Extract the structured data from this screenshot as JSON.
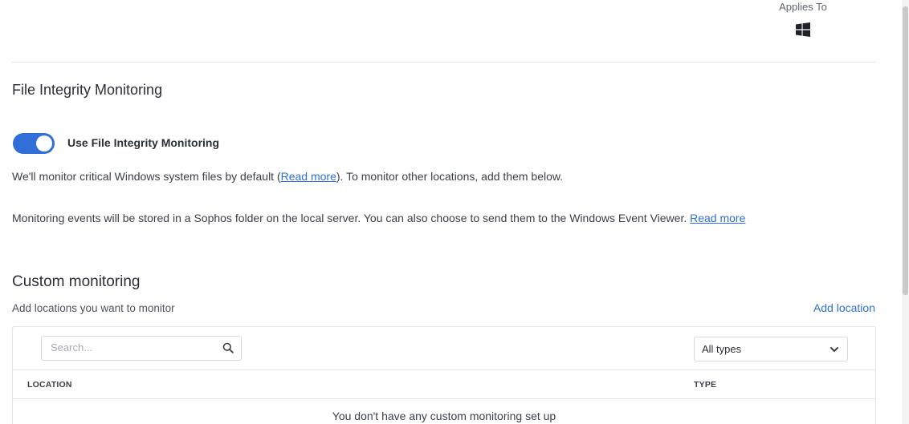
{
  "applies_to": {
    "label": "Applies To",
    "icon": "windows-icon"
  },
  "section": {
    "title": "File Integrity Monitoring"
  },
  "toggle": {
    "label": "Use File Integrity Monitoring",
    "state": "on",
    "color": "#2f6fd7"
  },
  "info": {
    "p1_before": "We'll monitor critical Windows system files by default (",
    "p1_link": "Read more",
    "p1_after": "). To monitor other locations, add them below.",
    "p2_text": "Monitoring events will be stored in a Sophos folder on the local server. You can also choose to send them to the Windows Event Viewer. ",
    "p2_link": "Read more"
  },
  "custom": {
    "title": "Custom monitoring",
    "subtitle": "Add locations you want to monitor",
    "add_label": "Add location"
  },
  "table": {
    "search_placeholder": "Search...",
    "search_icon": "search-icon",
    "filter_value": "All types",
    "filter_icon": "chevron-down-icon",
    "columns": [
      "LOCATION",
      "TYPE"
    ],
    "empty_message": "You don't have any custom monitoring set up"
  },
  "colors": {
    "link": "#2e6fd8",
    "accent": "#2f6fd7"
  }
}
